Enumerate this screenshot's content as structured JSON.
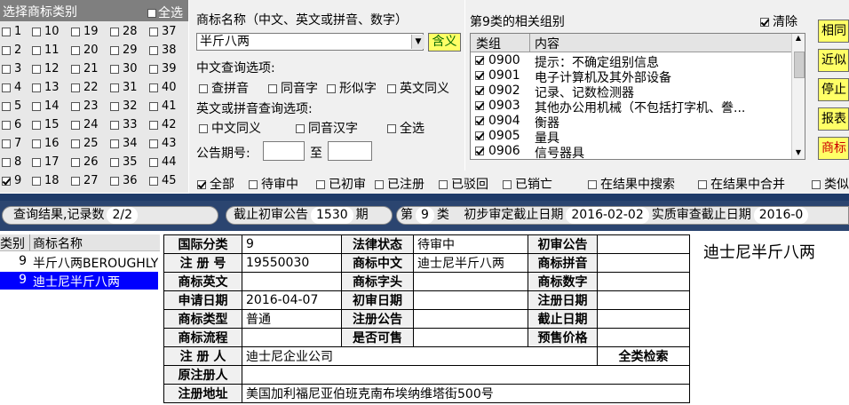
{
  "class_panel": {
    "title": "选择商标类别",
    "all_label": "全选",
    "classes": [
      "1",
      "10",
      "19",
      "28",
      "37",
      "2",
      "11",
      "20",
      "29",
      "38",
      "3",
      "12",
      "21",
      "30",
      "39",
      "4",
      "13",
      "22",
      "31",
      "40",
      "5",
      "14",
      "23",
      "32",
      "41",
      "6",
      "15",
      "24",
      "33",
      "42",
      "7",
      "16",
      "25",
      "34",
      "43",
      "8",
      "17",
      "26",
      "35",
      "44",
      "9",
      "18",
      "27",
      "36",
      "45"
    ],
    "checked_class": "9"
  },
  "search": {
    "name_label": "商标名称（中文、英文或拼音、数字）",
    "name_value": "半斤八两",
    "synonym_button": "含义",
    "cn_options_label": "中文查询选项:",
    "cn_options": [
      "查拼音",
      "同音字",
      "形似字",
      "英文同义"
    ],
    "en_options_label": "英文或拼音查询选项:",
    "en_options": [
      "中文同义",
      "同音汉字",
      "全选"
    ],
    "issue_label": "公告期号:",
    "issue_to": "至",
    "issue_from_value": "",
    "issue_to_value": ""
  },
  "groups": {
    "title": "第9类的相关组别",
    "clear_label": "清除",
    "col_group": "类组",
    "col_content": "内容",
    "rows": [
      {
        "code": "0900",
        "desc": "提示：不确定组别信息"
      },
      {
        "code": "0901",
        "desc": "电子计算机及其外部设备"
      },
      {
        "code": "0902",
        "desc": "记录、记数检测器"
      },
      {
        "code": "0903",
        "desc": "其他办公用机械（不包括打字机、誊..."
      },
      {
        "code": "0904",
        "desc": "衡器"
      },
      {
        "code": "0905",
        "desc": "量具"
      },
      {
        "code": "0906",
        "desc": "信号器具"
      }
    ]
  },
  "right_buttons": [
    "相同",
    "近似",
    "停止",
    "报表",
    "商标"
  ],
  "status_filters": [
    "全部",
    "待审中",
    "已初审",
    "已注册",
    "已驳回",
    "已销亡"
  ],
  "result_filters": [
    "在结果中搜索",
    "在结果中合并",
    "类似"
  ],
  "query_bar": {
    "result_label": "查询结果,记录数",
    "result_count": "2/2",
    "cutoff_label": "截止初审公告",
    "cutoff_issue": "1530",
    "issue_suffix": "期",
    "class_prefix": "第",
    "class_value": "9",
    "class_suffix": "类",
    "prelim_label": "初步审定截止日期",
    "prelim_date": "2016-02-02",
    "exam_label": "实质审查截止日期",
    "exam_date": "2016-0"
  },
  "results": {
    "col_class": "类别",
    "col_name": "商标名称",
    "rows": [
      {
        "cls": "9",
        "name": "半斤八两BEROUGHLY",
        "selected": false
      },
      {
        "cls": "9",
        "name": "迪士尼半斤八两",
        "selected": true
      }
    ]
  },
  "detail": {
    "intl_class_k": "国际分类",
    "intl_class_v": "9",
    "legal_status_k": "法律状态",
    "legal_status_v": "待审中",
    "prelim_pub_k": "初审公告",
    "prelim_pub_v": "",
    "reg_no_k": "注 册 号",
    "reg_no_v": "19550030",
    "cn_name_k": "商标中文",
    "cn_name_v": "迪士尼半斤八两",
    "pinyin_k": "商标拼音",
    "pinyin_v": "",
    "en_k": "商标英文",
    "en_v": "",
    "initials_k": "商标字头",
    "initials_v": "",
    "digits_k": "商标数字",
    "digits_v": "",
    "apply_date_k": "申请日期",
    "apply_date_v": "2016-04-07",
    "prelim_date_k": "初审日期",
    "prelim_date_v": "",
    "reg_date_k": "注册日期",
    "reg_date_v": "",
    "type_k": "商标类型",
    "type_v": "普通",
    "reg_pub_k": "注册公告",
    "reg_pub_v": "",
    "deadline_k": "截止日期",
    "deadline_v": "",
    "flow_k": "商标流程",
    "flow_v": "",
    "sellable_k": "是否可售",
    "sellable_v": "",
    "presale_k": "预售价格",
    "presale_v": "",
    "registrant_k": "注 册 人",
    "registrant_v": "迪士尼企业公司",
    "all_search": "全类检索",
    "orig_reg_k": "原注册人",
    "orig_reg_v": "",
    "address_k": "注册地址",
    "address_v": "美国加利福尼亚伯班克南布埃纳维塔街500号"
  },
  "preview": {
    "text": "迪士尼半斤八两"
  },
  "colors": {
    "button_yellow": "#ffff66",
    "bar_blue": "#2b4570",
    "select_blue": "#0000ff",
    "red_text": "#cc0000"
  }
}
